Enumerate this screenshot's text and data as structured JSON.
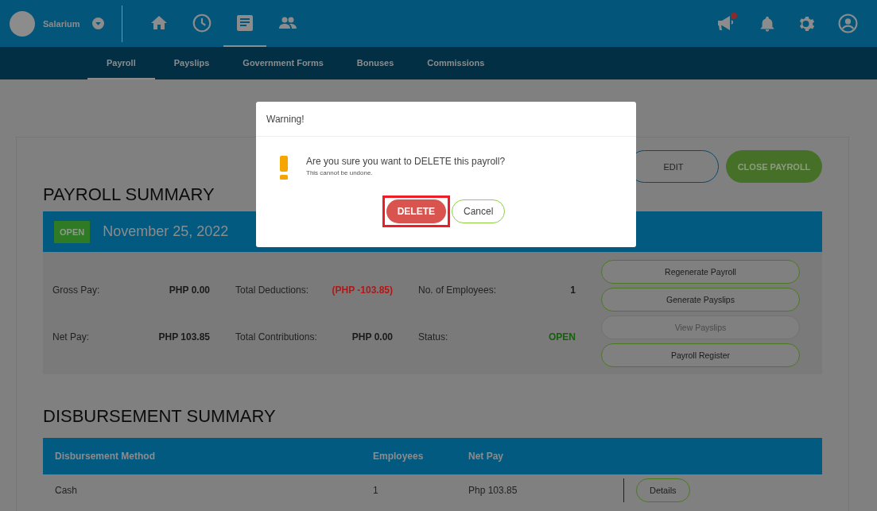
{
  "header": {
    "company": "Salarium",
    "nav": [
      {
        "kind": "home",
        "selected": false
      },
      {
        "kind": "clock",
        "selected": false
      },
      {
        "kind": "document",
        "selected": true
      },
      {
        "kind": "people",
        "selected": false
      }
    ],
    "announcements": {
      "unread": true
    }
  },
  "subnav": [
    {
      "label": "Payroll",
      "selected": true
    },
    {
      "label": "Payslips",
      "selected": false
    },
    {
      "label": "Government Forms",
      "selected": false
    },
    {
      "label": "Bonuses",
      "selected": false
    },
    {
      "label": "Commissions",
      "selected": false
    }
  ],
  "page_actions": [
    {
      "label": "EDIT",
      "kind": "outline"
    },
    {
      "label": "CLOSE PAYROLL",
      "kind": "primary"
    }
  ],
  "payroll_summary": {
    "title": "PAYROLL SUMMARY",
    "status_badge": "OPEN",
    "date": "November 25, 2022",
    "rows": [
      [
        {
          "label": "Gross Pay:",
          "value": "PHP 0.00",
          "color": "#1a1a1a"
        },
        {
          "label": "Total Deductions:",
          "value": "(PHP -103.85)",
          "color": "#b01818"
        },
        {
          "label": "No. of Employees:",
          "value": "1",
          "color": "#1a1a1a"
        }
      ],
      [
        {
          "label": "Net Pay:",
          "value": "PHP 103.85",
          "color": "#1a1a1a"
        },
        {
          "label": "Total Contributions:",
          "value": "PHP 0.00",
          "color": "#1a1a1a"
        },
        {
          "label": "Status:",
          "value": "OPEN",
          "color": "#15600c"
        }
      ]
    ],
    "actions": [
      {
        "label": "Regenerate Payroll",
        "disabled": false
      },
      {
        "label": "Generate Payslips",
        "disabled": false
      },
      {
        "label": "View Payslips",
        "disabled": true
      },
      {
        "label": "Payroll Register",
        "disabled": false
      }
    ]
  },
  "disbursement_summary": {
    "title": "DISBURSEMENT SUMMARY",
    "columns": [
      "Disbursement Method",
      "Employees",
      "Net Pay"
    ],
    "rows": [
      {
        "cells": [
          "Cash",
          "1",
          "Php 103.85"
        ],
        "action": "Details"
      }
    ]
  },
  "dialog": {
    "title": "Warning!",
    "message": "Are you sure you want to DELETE this payroll?",
    "note": "This cannot be undone.",
    "buttons": [
      {
        "label": "DELETE",
        "kind": "danger",
        "highlighted": true
      },
      {
        "label": "Cancel",
        "kind": "secondary",
        "highlighted": false
      }
    ]
  }
}
